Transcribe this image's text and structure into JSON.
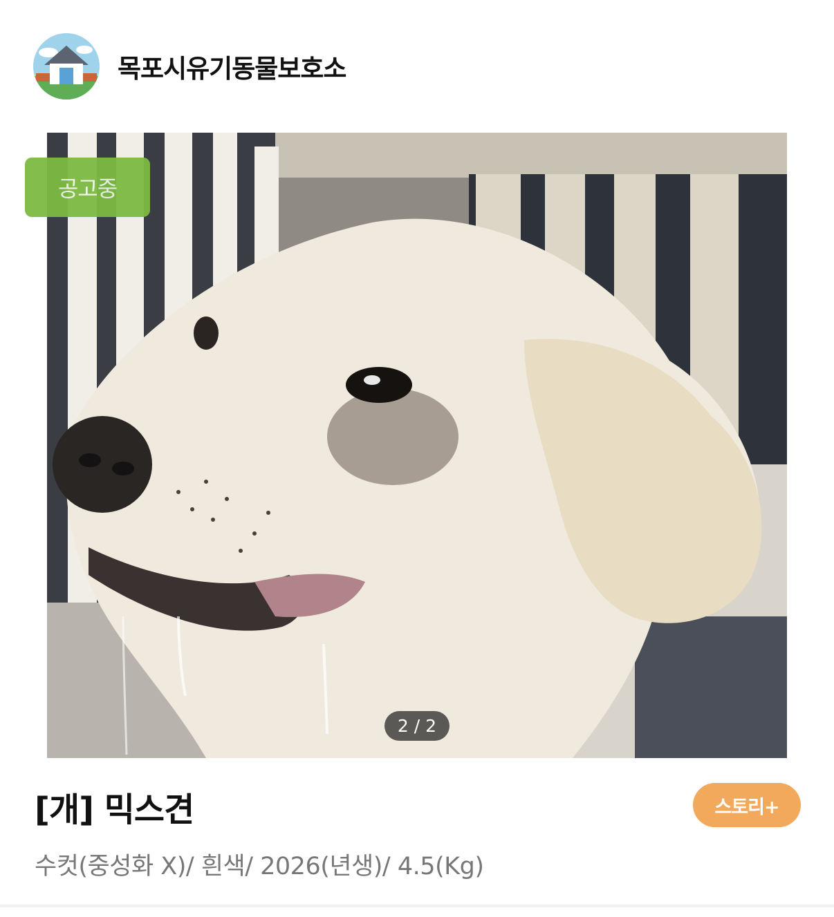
{
  "shelter": {
    "name": "목포시유기동물보호소"
  },
  "photo": {
    "status_badge": "공고중",
    "pager": "2 / 2"
  },
  "animal": {
    "title": "[개] 믹스견",
    "details": "수컷(중성화 X)/ 흰색/ 2026(년생)/ 4.5(Kg)"
  },
  "actions": {
    "story_label": "스토리+"
  },
  "colors": {
    "badge_green": "#7dbb43",
    "story_orange": "#f2a95b"
  }
}
